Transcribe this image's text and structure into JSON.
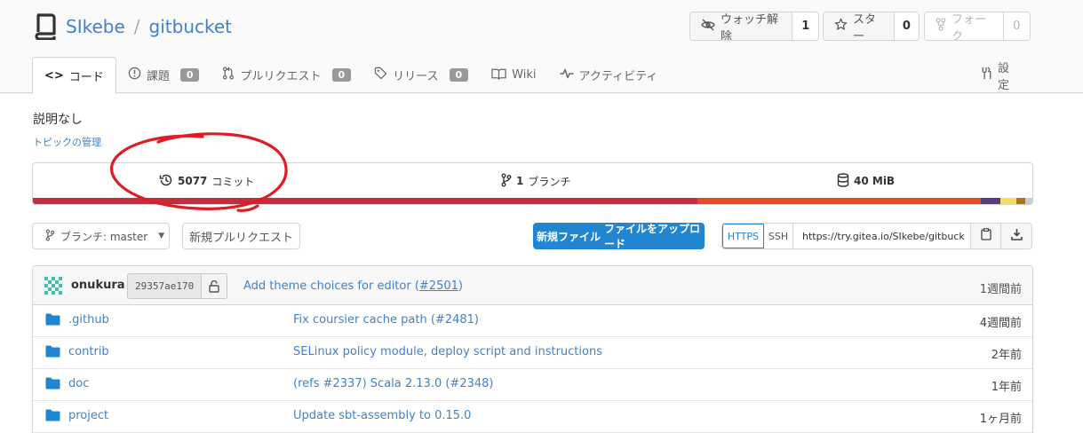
{
  "repo": {
    "owner": "SIkebe",
    "separator": "/",
    "name": "gitbucket"
  },
  "actions": {
    "watch": {
      "label": "ウォッチ解除",
      "count": "1"
    },
    "star": {
      "label": "スター",
      "count": "0"
    },
    "fork": {
      "label": "フォーク",
      "count": "0"
    }
  },
  "tabs": [
    {
      "label": "コード"
    },
    {
      "label": "課題",
      "badge": "0"
    },
    {
      "label": "プルリクエスト",
      "badge": "0"
    },
    {
      "label": "リリース",
      "badge": "0"
    },
    {
      "label": "Wiki"
    },
    {
      "label": "アクティビティ"
    }
  ],
  "settings_label": "設定",
  "description": "説明なし",
  "topics_link": "トピックの管理",
  "stats": {
    "commits": {
      "num": "5077",
      "label": "コミット"
    },
    "branches": {
      "num": "1",
      "label": "ブランチ"
    },
    "size": {
      "num": "40 MiB"
    }
  },
  "language_bar": [
    {
      "color": "#c22d40",
      "fraction": 0.665
    },
    {
      "color": "#e44b23",
      "fraction": 0.283
    },
    {
      "color": "#563d7c",
      "fraction": 0.02
    },
    {
      "color": "#f1e05a",
      "fraction": 0.016
    },
    {
      "color": "#b07219",
      "fraction": 0.009
    },
    {
      "color": "#cccccc",
      "fraction": 0.007
    }
  ],
  "toolbar": {
    "branch_label": "ブランチ: master",
    "new_pr_label": "新規プルリクエスト",
    "new_file_label": "新規ファイル",
    "upload_label": "ファイルをアップロード",
    "https_label": "HTTPS",
    "ssh_label": "SSH",
    "clone_url": "https://try.gitea.io/SIkebe/gitbuck"
  },
  "last_commit": {
    "author": "onukura",
    "sha": "29357ae170",
    "message": "Add theme choices for editor (",
    "pr": "#2501",
    "message_end": ")",
    "age": "1週間前"
  },
  "files": [
    {
      "name": ".github",
      "message": "Fix coursier cache path (#2481)",
      "age": "4週間前"
    },
    {
      "name": "contrib",
      "message": "SELinux policy module, deploy script and instructions",
      "age": "2年前"
    },
    {
      "name": "doc",
      "message": "(refs #2337) Scala 2.13.0 (#2348)",
      "age": "1年前"
    },
    {
      "name": "project",
      "message": "Update sbt-assembly to 0.15.0",
      "age": "1ヶ月前"
    }
  ],
  "colors": {
    "accent": "#2185d0",
    "link": "#4183c4",
    "annotation": "#e01b24"
  }
}
